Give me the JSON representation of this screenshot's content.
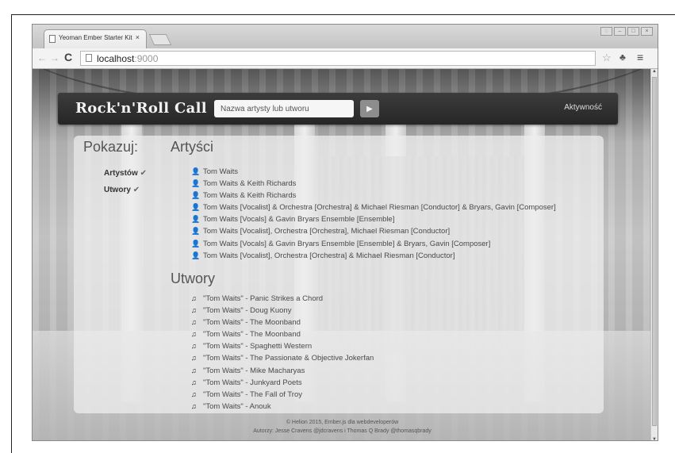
{
  "browser": {
    "tab_title": "Yeoman Ember Starter Kit",
    "tab_close": "×",
    "url_host": "localhost",
    "url_port": ":9000"
  },
  "app": {
    "brand": "Rock'n'Roll Call",
    "search_placeholder": "Nazwa artysty lub utworu",
    "play_label": "▶",
    "activity_link": "Aktywność"
  },
  "sidebar": {
    "title": "Pokazuj:",
    "filters": [
      {
        "label": "Artystów",
        "check": "✔"
      },
      {
        "label": "Utwory",
        "check": "✔"
      }
    ]
  },
  "artists": {
    "title": "Artyści",
    "items": [
      "Tom Waits",
      "Tom Waits & Keith Richards",
      "Tom Waits & Keith Richards",
      "Tom Waits [Vocalist] & Orchestra [Orchestra] & Michael Riesman [Conductor] & Bryars, Gavin [Composer]",
      "Tom Waits [Vocals] & Gavin Bryars Ensemble [Ensemble]",
      "Tom Waits [Vocalist], Orchestra [Orchestra], Michael Riesman [Conductor]",
      "Tom Waits [Vocals] & Gavin Bryars Ensemble [Ensemble] & Bryars, Gavin [Composer]",
      "Tom Waits [Vocalist], Orchestra [Orchestra] & Michael Riesman [Conductor]"
    ]
  },
  "tracks": {
    "title": "Utwory",
    "items": [
      "\"Tom Waits\" - Panic Strikes a Chord",
      "\"Tom Waits\" - Doug Kuony",
      "\"Tom Waits\" - The Moonband",
      "\"Tom Waits\" - The Moonband",
      "\"Tom Waits\" - Spaghetti Western",
      "\"Tom Waits\" - The Passionate & Objective Jokerfan",
      "\"Tom Waits\" - Mike Macharyas",
      "\"Tom Waits\" - Junkyard Poets",
      "\"Tom Waits\" - The Fall of Troy",
      "\"Tom Waits\" - Anouk"
    ]
  },
  "footer": {
    "line1": "© Helion 2015, Ember.js dla webdeveloperów",
    "line2": "Autorzy: Jesse Cravens @jdcravens i Thomas Q Brady @thomasqbrady"
  }
}
